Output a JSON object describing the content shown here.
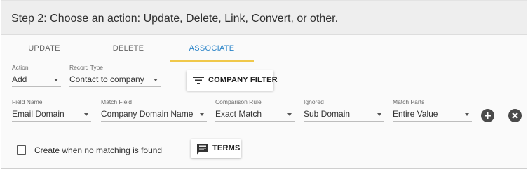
{
  "header": {
    "title": "Step 2: Choose an action: Update, Delete, Link, Convert, or other."
  },
  "tabs": [
    {
      "label": "UPDATE",
      "active": false
    },
    {
      "label": "DELETE",
      "active": false
    },
    {
      "label": "ASSOCIATE",
      "active": true
    }
  ],
  "action": {
    "label": "Action",
    "value": "Add"
  },
  "record_type": {
    "label": "Record Type",
    "value": "Contact to company"
  },
  "company_filter_button": {
    "label": "COMPANY FILTER",
    "icon": "filter-icon"
  },
  "match_row": {
    "field_name": {
      "label": "Field Name",
      "value": "Email Domain"
    },
    "match_field": {
      "label": "Match Field",
      "value": "Company Domain Name"
    },
    "comparison_rule": {
      "label": "Comparison Rule",
      "value": "Exact Match"
    },
    "ignored": {
      "label": "Ignored",
      "value": "Sub Domain"
    },
    "match_parts": {
      "label": "Match Parts",
      "value": "Entire Value"
    },
    "add_icon": "plus-circle-icon",
    "remove_icon": "close-circle-icon"
  },
  "create_checkbox": {
    "label": "Create when no matching is found",
    "checked": false
  },
  "terms_button": {
    "label": "TERMS",
    "icon": "comment-icon"
  },
  "colors": {
    "accent": "#2b84c8",
    "tab_indicator": "#f0c84a",
    "header_bg": "#eeeeee"
  }
}
